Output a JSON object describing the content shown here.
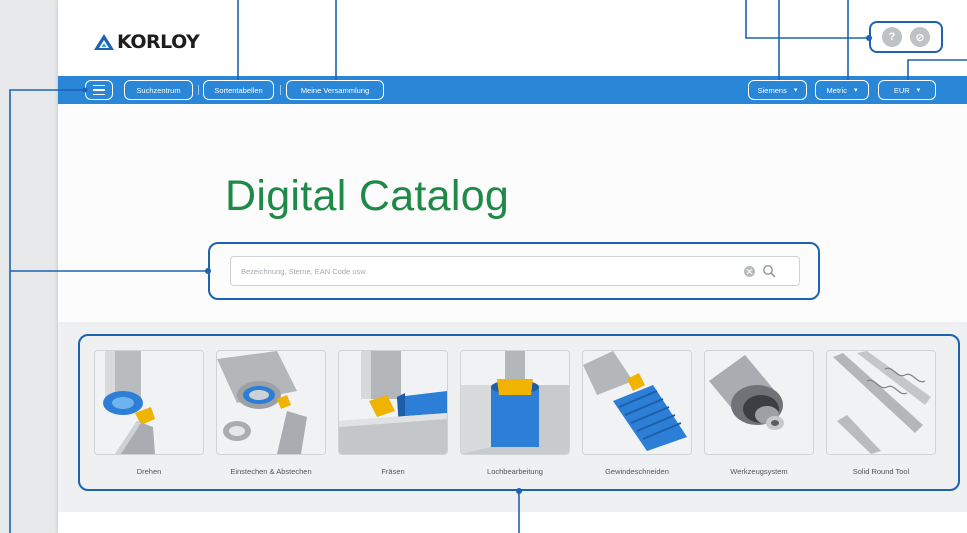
{
  "brand": {
    "name": "KORLOY",
    "color": "#1d63b1",
    "accent_green": "#1f8a47",
    "nav_blue": "#2a86d7"
  },
  "header_icons": [
    {
      "name": "help-icon",
      "glyph": "?"
    },
    {
      "name": "link-icon",
      "glyph": "⊘"
    }
  ],
  "nav": {
    "menu_icon": "hamburger-icon",
    "items": [
      "Suchzentrum",
      "Sortentabellen",
      "Meine Versammlung"
    ],
    "right": [
      {
        "label": "Siemens"
      },
      {
        "label": "Metric"
      },
      {
        "label": "EUR"
      }
    ]
  },
  "hero": {
    "title": "Digital Catalog",
    "search_placeholder": "Bezeichnung, Sterne, EAN Code usw.",
    "search_value": ""
  },
  "categories": [
    {
      "label": "Drehen"
    },
    {
      "label": "Einstechen & Abstechen"
    },
    {
      "label": "Fräsen"
    },
    {
      "label": "Lochbearbeitung"
    },
    {
      "label": "Gewindeschneiden"
    },
    {
      "label": "Werkzeugsystem"
    },
    {
      "label": "Solid Round Tool"
    }
  ]
}
